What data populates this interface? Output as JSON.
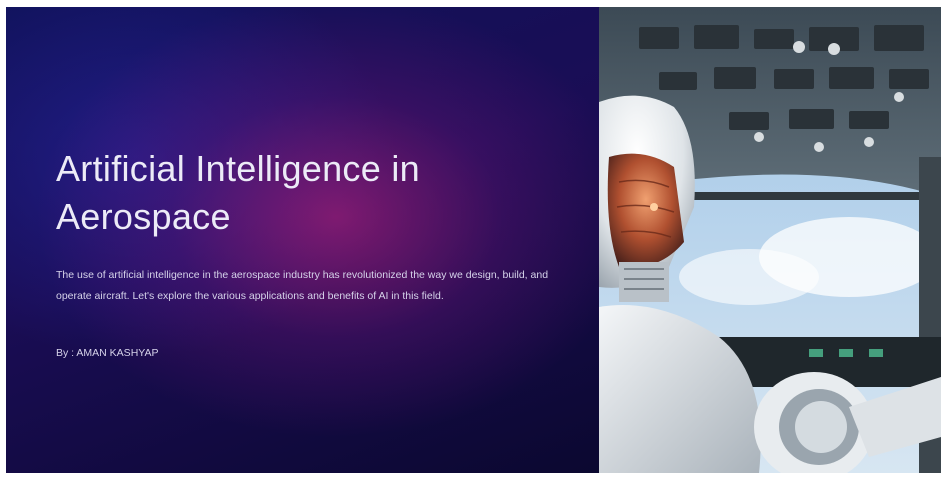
{
  "slide": {
    "title": "Artificial Intelligence in Aerospace",
    "description": "The use of artificial intelligence in the aerospace industry has revolutionized the way we design, build, and operate aircraft. Let's explore the various applications and benefits of AI in this field.",
    "author": "By : AMAN KASHYAP"
  },
  "image": {
    "subject": "robot-pilot-in-cockpit"
  },
  "colors": {
    "background_dark": "#0d0a3a",
    "accent_magenta": "#a01e78",
    "text": "#ecebf7"
  }
}
